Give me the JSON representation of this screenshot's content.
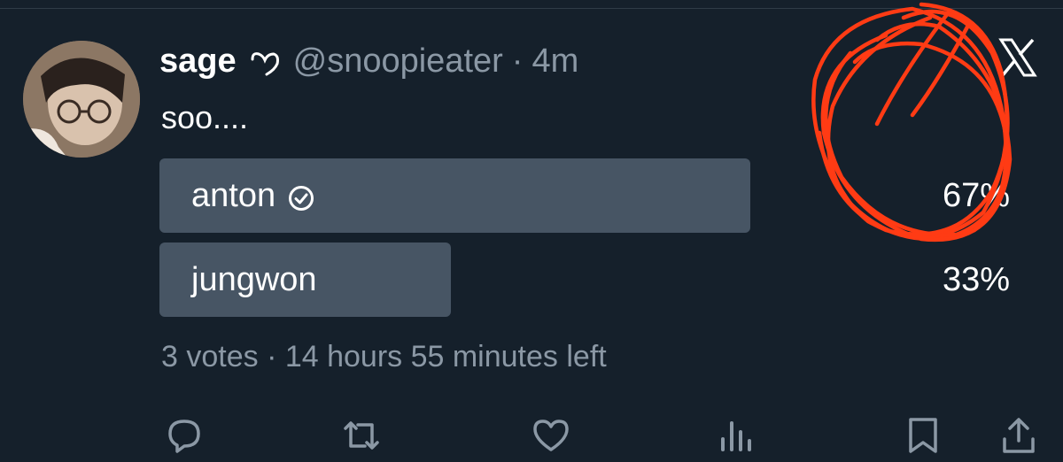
{
  "tweet": {
    "display_name": "sage",
    "name_emoji": "heart-outline-icon",
    "handle": "@snoopieater",
    "separator": "·",
    "time": "4m",
    "text": "soo...."
  },
  "poll": {
    "options": [
      {
        "label": "anton",
        "percent": "67%",
        "fraction": 0.67,
        "selected_icon": "check-circle-icon"
      },
      {
        "label": "jungwon",
        "percent": "33%",
        "fraction": 0.33
      }
    ],
    "meta": "3 votes · 14 hours 55 minutes left"
  },
  "actions": [
    "reply-icon",
    "retweet-icon",
    "like-icon",
    "views-icon",
    "bookmark-icon",
    "share-icon"
  ],
  "colors": {
    "background": "#15202b",
    "bar": "#475564",
    "muted": "#8b98a5",
    "scribble": "#ff3b14"
  }
}
